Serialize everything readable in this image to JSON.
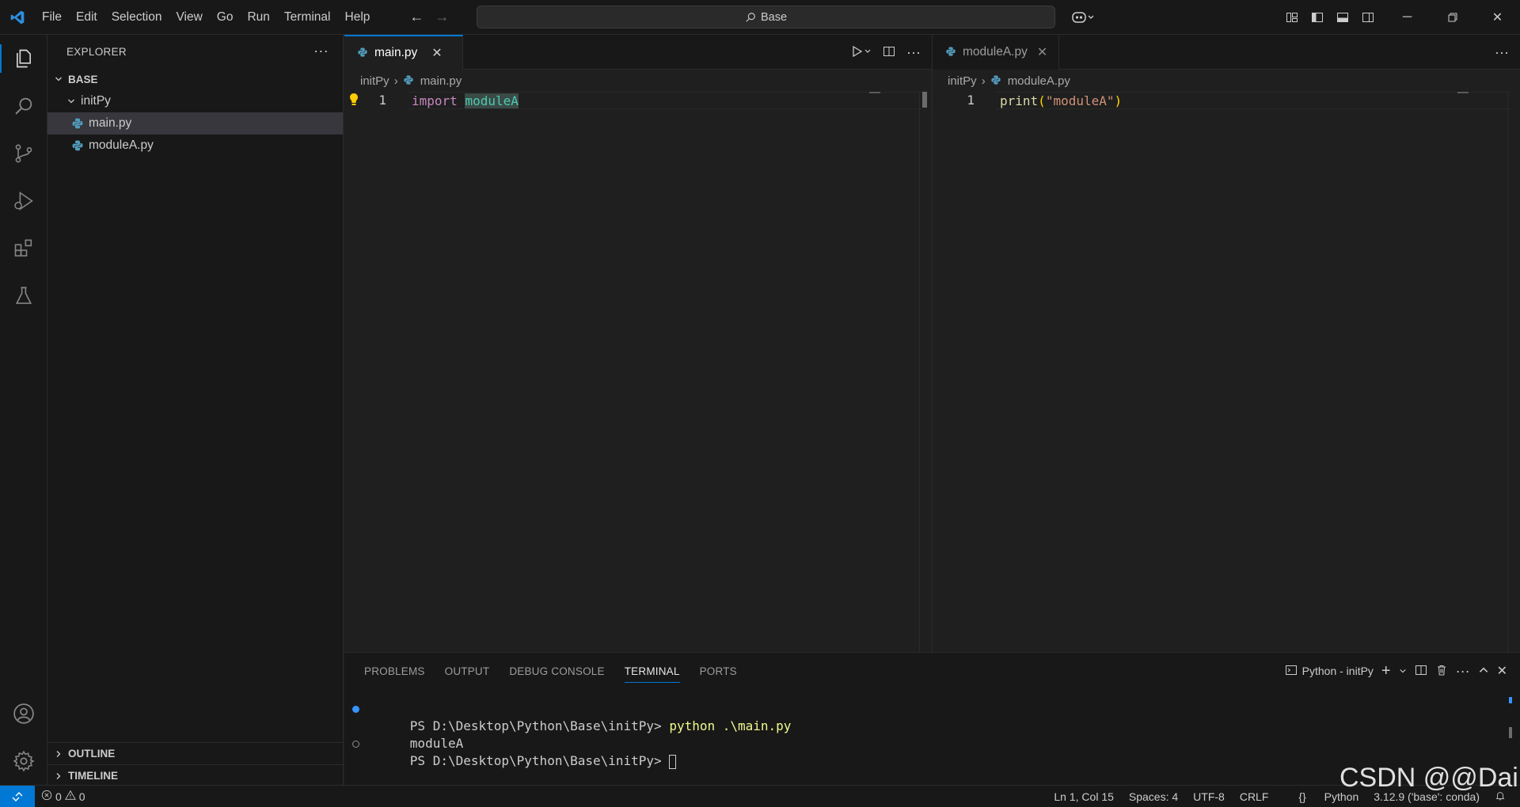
{
  "titlebar": {
    "menu": [
      "File",
      "Edit",
      "Selection",
      "View",
      "Go",
      "Run",
      "Terminal",
      "Help"
    ],
    "search_text": "Base"
  },
  "activitybar": {
    "icons": [
      "explorer-icon",
      "search-icon",
      "source-control-icon",
      "run-debug-icon",
      "extensions-icon",
      "testing-icon",
      "account-icon",
      "manage-gear-icon"
    ]
  },
  "sidebar": {
    "title": "EXPLORER",
    "more": "···",
    "workspace": "BASE",
    "folder": "initPy",
    "files": [
      "main.py",
      "moduleA.py"
    ],
    "outline": "OUTLINE",
    "timeline": "TIMELINE"
  },
  "editor_left": {
    "tab": "main.py",
    "close": "✕",
    "breadcrumb_folder": "initPy",
    "breadcrumb_file": "main.py",
    "line_number": "1",
    "code_keyword": "import",
    "code_module": "moduleA"
  },
  "editor_right": {
    "tab": "moduleA.py",
    "close": "✕",
    "breadcrumb_folder": "initPy",
    "breadcrumb_file": "moduleA.py",
    "line_number": "1",
    "code_fn": "print",
    "code_open": "(",
    "code_str": "\"moduleA\"",
    "code_close": ")"
  },
  "panel": {
    "tabs": [
      "PROBLEMS",
      "OUTPUT",
      "DEBUG CONSOLE",
      "TERMINAL",
      "PORTS"
    ],
    "active_tab": "TERMINAL",
    "terminal_name": "Python - initPy",
    "lines": [
      {
        "prompt": "PS D:\\Desktop\\Python\\Base\\initPy> ",
        "cmd": "python .\\main.py"
      },
      {
        "prompt": "moduleA",
        "cmd": ""
      },
      {
        "prompt": "PS D:\\Desktop\\Python\\Base\\initPy> ",
        "cmd": ""
      }
    ]
  },
  "statusbar": {
    "errors": "0",
    "warnings": "0",
    "position": "Ln 1, Col 15",
    "spaces": "Spaces: 4",
    "encoding": "UTF-8",
    "eol": "CRLF",
    "language": "Python",
    "interpreter": "3.12.9 ('base': conda)"
  },
  "watermark": "CSDN @@Dai",
  "colors": {
    "accent": "#0078d4",
    "background": "#1f1f1f",
    "sidebar": "#181818"
  }
}
